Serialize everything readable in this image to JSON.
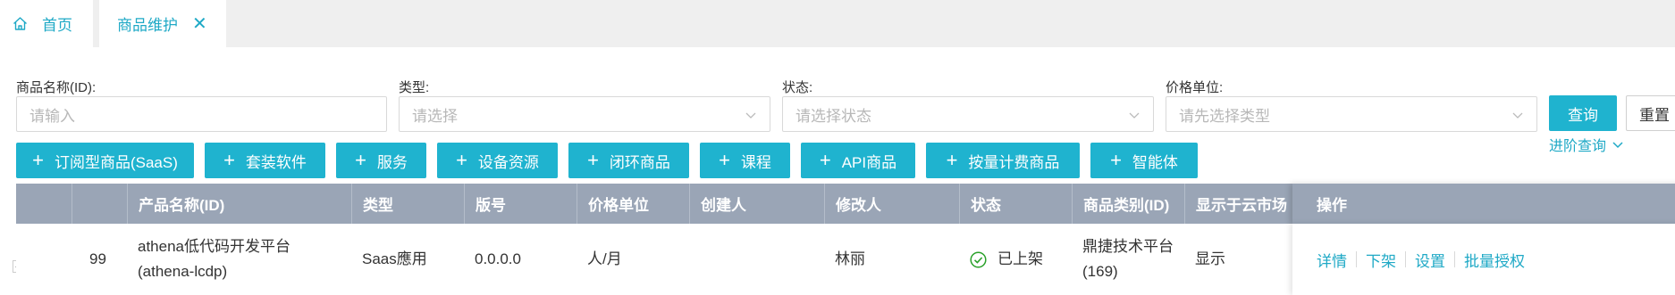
{
  "tabs": {
    "home_label": "首页",
    "active_label": "商品维护",
    "close_glyph": "✕"
  },
  "filters": {
    "name_label": "商品名称(ID):",
    "name_placeholder": "请输入",
    "type_label": "类型:",
    "type_placeholder": "请选择",
    "status_label": "状态:",
    "status_placeholder": "请选择状态",
    "unit_label": "价格单位:",
    "unit_placeholder": "请先选择类型",
    "query_label": "查询",
    "reset_label": "重置",
    "advanced_label": "进阶查询"
  },
  "actions": [
    "订阅型商品(SaaS)",
    "套装软件",
    "服务",
    "设备资源",
    "闭环商品",
    "课程",
    "API商品",
    "按量计费商品",
    "智能体"
  ],
  "table": {
    "headers": [
      "产品名称(ID)",
      "类型",
      "版号",
      "价格单位",
      "创建人",
      "修改人",
      "状态",
      "商品类别(ID)",
      "显示于云市场"
    ],
    "op_header": "操作",
    "rows": [
      {
        "index": "99",
        "name_line1": "athena低代码开发平台",
        "name_line2": "(athena-lcdp)",
        "type": "Saas應用",
        "version": "0.0.0.0",
        "unit": "人/月",
        "creator": "",
        "modifier": "林丽",
        "status": "已上架",
        "category_line1": "鼎捷技术平台",
        "category_line2": "(169)",
        "display": "显示",
        "ops": [
          "详情",
          "下架",
          "设置",
          "批量授权"
        ]
      }
    ]
  },
  "colors": {
    "accent": "#1fb3cf",
    "link": "#1fa9c6",
    "header_bg": "#9aa5b6",
    "status_ok": "#2aa12a"
  }
}
